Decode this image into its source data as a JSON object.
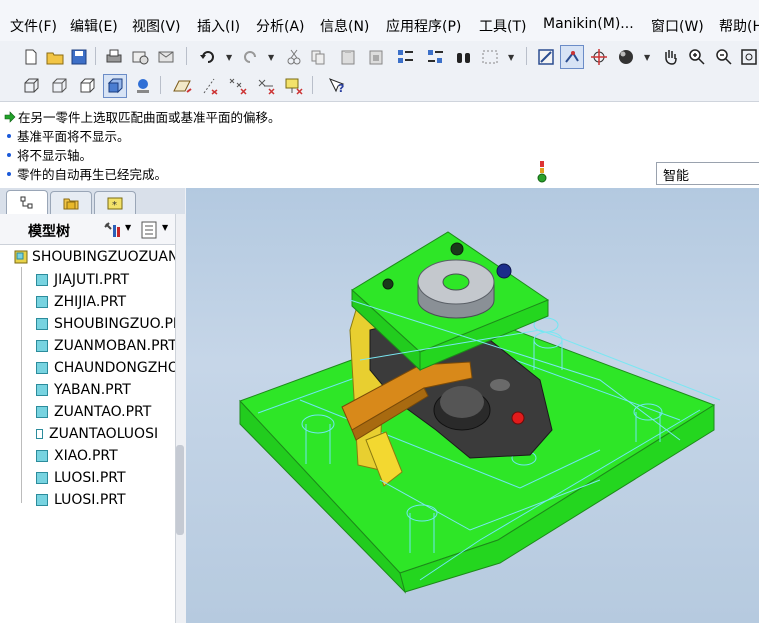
{
  "menu": [
    "文件(F)",
    "编辑(E)",
    "视图(V)",
    "插入(I)",
    "分析(A)",
    "信息(N)",
    "应用程序(P)",
    "工具(T)",
    "Manikin(M)...",
    "窗口(W)",
    "帮助(H)"
  ],
  "toolbar1_icons": [
    "new-file-icon",
    "open-folder-icon",
    "save-icon",
    "print-icon",
    "send-mail-icon",
    "mail-icon",
    "undo-icon",
    "redo-icon",
    "cut-icon",
    "copy-icon",
    "paste-icon",
    "paste-special-icon",
    "regenerate-icon",
    "regen-manager-icon",
    "find-icon",
    "select-box-icon",
    "refit-view-icon",
    "datum-display-icon",
    "spin-center-icon",
    "sphere-icon",
    "pan-hand-icon",
    "zoom-in-icon",
    "zoom-out-icon",
    "zoom-fit-icon"
  ],
  "toolbar2_icons": [
    "wireframe-icon",
    "hidden-line-icon",
    "no-hidden-icon",
    "shading-icon",
    "appearance-icon",
    "plane-display-icon",
    "axis-display-icon",
    "point-display-icon",
    "csys-display-icon",
    "annotation-display-icon",
    "context-help-icon"
  ],
  "messages": [
    {
      "type": "arrow",
      "text": "在另一零件上选取匹配曲面或基准平面的偏移。"
    },
    {
      "type": "bullet",
      "text": "基准平面将不显示。"
    },
    {
      "type": "bullet",
      "text": "将不显示轴。"
    },
    {
      "type": "bullet",
      "text": "零件的自动再生已经完成。"
    }
  ],
  "filter": {
    "value": "智能"
  },
  "left_tabs": [
    "model-tree-tab",
    "folder-browser-tab",
    "favorites-tab"
  ],
  "tree": {
    "title": "模型树",
    "root": "SHOUBINGZUOZUAN",
    "items": [
      "JIAJUTI.PRT",
      "ZHIJIA.PRT",
      "SHOUBINGZUO.PRT",
      "ZUANMOBAN.PRT",
      "CHAUNDONGZHOU",
      "YABAN.PRT",
      "ZUANTAO.PRT",
      "ZUANTAOLUOSI",
      "XIAO.PRT",
      "LUOSI.PRT",
      "LUOSI.PRT"
    ]
  },
  "colors": {
    "accent_green": "#33ee2a",
    "bushing_gray": "#b9bdc2",
    "handle_orange": "#d88a14",
    "link_dark": "#3d3d3d",
    "background_blue": "#b8cbe0"
  }
}
